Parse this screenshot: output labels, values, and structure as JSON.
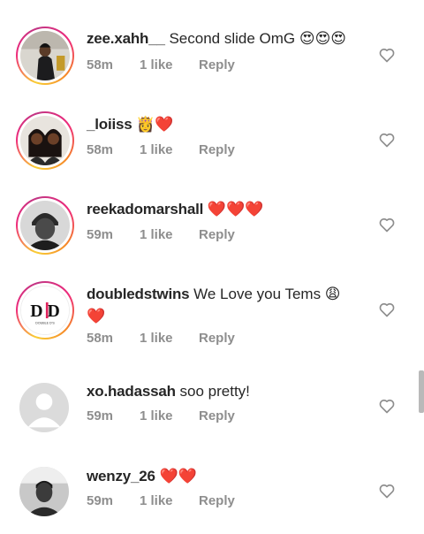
{
  "comments": [
    {
      "username": "zee.xahh__",
      "text": " Second slide OmG 😍😍😍",
      "time": "58m",
      "likes": "1 like",
      "reply": "Reply",
      "has_ring": true,
      "avatar": "person-dark-outfit"
    },
    {
      "username": "_loiiss",
      "text": " 👸❤️",
      "time": "58m",
      "likes": "1 like",
      "reply": "Reply",
      "has_ring": true,
      "avatar": "two-women"
    },
    {
      "username": "reekadomarshall",
      "text": " ❤️❤️❤️",
      "time": "59m",
      "likes": "1 like",
      "reply": "Reply",
      "has_ring": true,
      "avatar": "man-beanie"
    },
    {
      "username": "doubledstwins",
      "text": " We Love you Tems 😩 ❤️",
      "time": "58m",
      "likes": "1 like",
      "reply": "Reply",
      "has_ring": true,
      "avatar": "doubled-logo",
      "logo_text": "D D",
      "logo_caption": "DOUBLE D'S"
    },
    {
      "username": "xo.hadassah",
      "text": " soo pretty!",
      "time": "59m",
      "likes": "1 like",
      "reply": "Reply",
      "has_ring": false,
      "avatar": "default-placeholder"
    },
    {
      "username": "wenzy_26",
      "text": " ❤️❤️",
      "time": "59m",
      "likes": "1 like",
      "reply": "Reply",
      "has_ring": false,
      "avatar": "man-selfie"
    }
  ],
  "icons": {
    "like": "heart-outline-icon"
  },
  "colors": {
    "text": "#262626",
    "meta": "#8e8e8e",
    "heart": "#e0245e",
    "story_ring": [
      "#f9ce34",
      "#ee2a7b",
      "#c13584"
    ]
  }
}
